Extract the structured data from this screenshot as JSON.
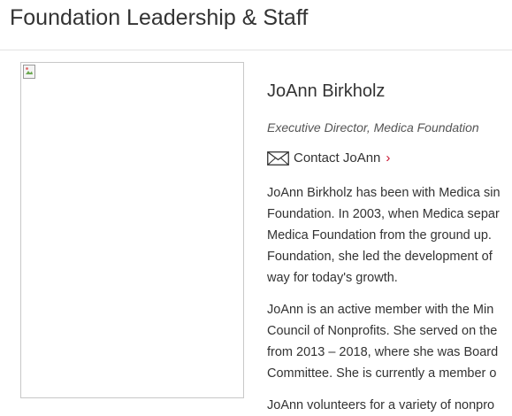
{
  "header": {
    "title": "Foundation Leadership & Staff"
  },
  "profile": {
    "name": "JoAnn Birkholz",
    "role": "Executive Director, Medica Foundation",
    "contact_label": "Contact JoAnn",
    "photo_icon": "broken-image-icon",
    "bio": {
      "paragraph1": [
        "JoAnn Birkholz has been with Medica sin",
        "Foundation. In 2003, when Medica separ",
        "Medica Foundation from the ground up.",
        "Foundation, she led the development of",
        "way for today's growth."
      ],
      "paragraph2": [
        "JoAnn is an active member with the Min",
        "Council of Nonprofits. She served on the",
        "from 2013 – 2018, where she was Board",
        "Committee.  She is currently a member o"
      ],
      "paragraph3": [
        "JoAnn volunteers for a variety of nonpro"
      ]
    }
  },
  "colors": {
    "accent": "#c8102e",
    "text": "#333333",
    "divider": "#e3e3e3"
  }
}
